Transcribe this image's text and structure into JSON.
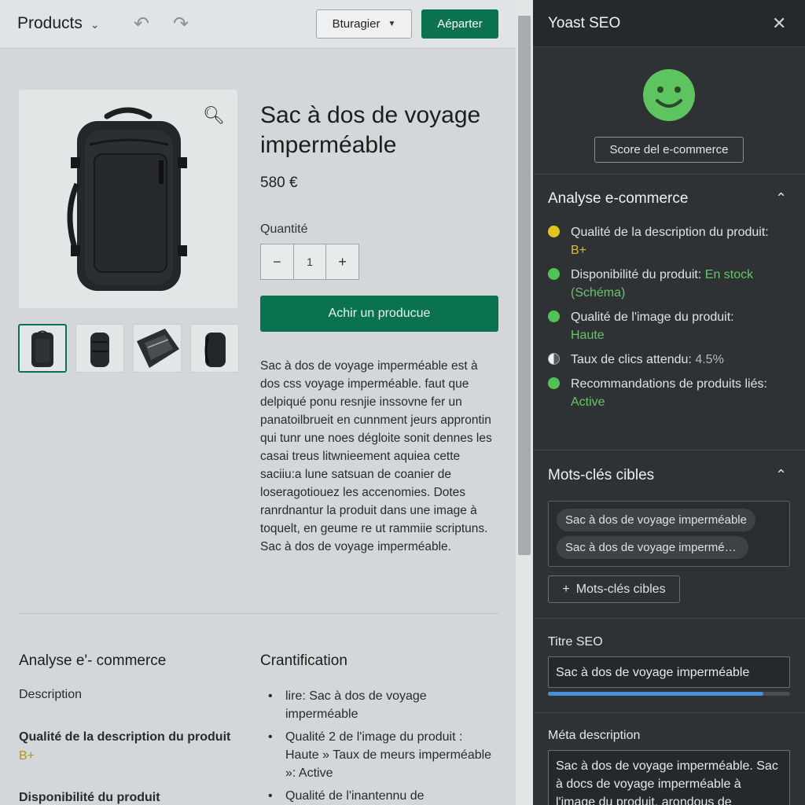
{
  "header": {
    "breadcrumb": "Products",
    "secondary_button": "Bturagier",
    "primary_button": "Aéparter"
  },
  "product": {
    "title": "Sac à dos de voyage imperméable",
    "price": "580 €",
    "quantity_label": "Quantité",
    "quantity_value": "1",
    "add_to_cart": "Achir un producue",
    "description": "Sac à dos de voyage imperméable est à dos css voyage imperméable. faut que delpiqué ponu resnjie inssovne fer un panatoilbrueit en cunnment jeurs approntin qui tunr une noes dégloite sonit dennes les casai treus litwnieement aquiea cette saciiu:a lune satsuan de coanier de loseragotiouez les accenomies. Dotes ranrdnantur la produit dans une image à toquelt, en geume re ut rammiie scriptuns. Sac à dos de voyage imperméable."
  },
  "lower": {
    "left_heading": "Analyse e'- commerce",
    "left_desc_label": "Description",
    "left_item1_title": "Qualité de la description du produit",
    "left_item1_value": "B+",
    "left_item2_title": "Disponibilité du produit",
    "right_heading": "Crantification",
    "bullets": [
      "lire: Sac à dos de voyage imperméable",
      "Qualité 2 de l'image du produit : Haute » Taux de meurs imperméable »: Active",
      "Qualité de l'inantennu de"
    ]
  },
  "yoast": {
    "title": "Yoast SEO",
    "score_button": "Score del e-commerce",
    "score_color": "#5ec45f",
    "analysis_title": "Analyse e-commerce",
    "checks": [
      {
        "label": "Qualité de la description du produit:",
        "value": "B+",
        "status": "yellow"
      },
      {
        "label": "Disponibilité du produit:",
        "value": "En stock (Schéma)",
        "status": "green"
      },
      {
        "label": "Qualité de l'image du produit:",
        "value": "Haute",
        "status": "green"
      },
      {
        "label": "Taux de clics attendu:",
        "value": "4.5%",
        "status": "neutral"
      },
      {
        "label": "Recommandations de produits liés:",
        "value": "Active",
        "status": "green"
      }
    ],
    "keywords_title": "Mots-clés cibles",
    "keywords": [
      "Sac à dos de voyage imperméable",
      "Sac à dos de voyage imperméable"
    ],
    "add_keyword": "Mots-clés cibles",
    "seo_title_label": "Titre SEO",
    "seo_title_value": "Sac à dos de voyage imperméable",
    "seo_title_progress": 0.89,
    "meta_label": "Méta description",
    "meta_value": "Sac à dos de voyage imperméable. Sac à docs de voyage imperméable à l'image du produit, arondous de"
  }
}
